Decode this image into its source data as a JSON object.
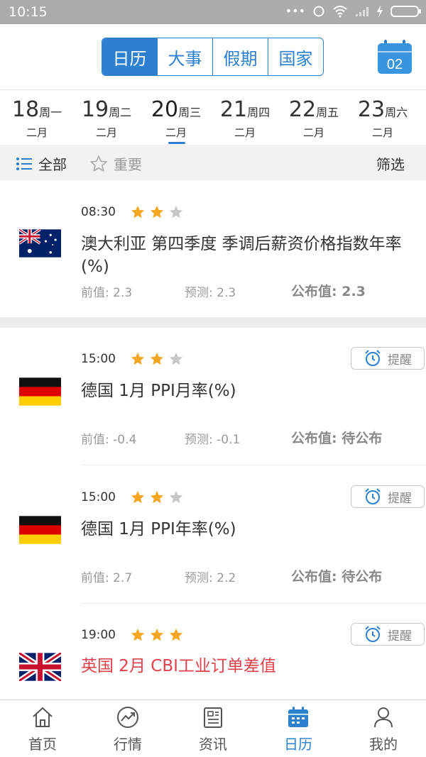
{
  "status_bar": {
    "time": "10:15",
    "dots": "•••"
  },
  "header": {
    "tabs": [
      {
        "label": "日历",
        "active": true
      },
      {
        "label": "大事",
        "active": false
      },
      {
        "label": "假期",
        "active": false
      },
      {
        "label": "国家",
        "active": false
      }
    ],
    "calendar_button_day": "02"
  },
  "dates": [
    {
      "day": "18",
      "weekday": "周一",
      "month": "二月",
      "active": false
    },
    {
      "day": "19",
      "weekday": "周二",
      "month": "二月",
      "active": false
    },
    {
      "day": "20",
      "weekday": "周三",
      "month": "二月",
      "active": true
    },
    {
      "day": "21",
      "weekday": "周四",
      "month": "二月",
      "active": false
    },
    {
      "day": "22",
      "weekday": "周五",
      "month": "二月",
      "active": false
    },
    {
      "day": "23",
      "weekday": "周六",
      "month": "二月",
      "active": false
    }
  ],
  "filter": {
    "all_label": "全部",
    "important_label": "重要",
    "screen_label": "筛选"
  },
  "events": [
    {
      "time": "08:30",
      "stars": 2,
      "flag": "australia-flag",
      "title": "澳大利亚 第四季度 季调后薪资价格指数年率(%)",
      "previous": "前值: 2.3",
      "forecast": "预测: 2.3",
      "actual_label": "公布值: ",
      "actual": "2.3",
      "remind": null
    },
    {
      "time": "15:00",
      "stars": 2,
      "flag": "germany-flag",
      "title": "德国 1月 PPI月率(%)",
      "previous": "前值: -0.4",
      "forecast": "预测: -0.1",
      "actual_label": "公布值: ",
      "actual": "待公布",
      "remind": "提醒"
    },
    {
      "time": "15:00",
      "stars": 2,
      "flag": "germany-flag",
      "title": "德国 1月 PPI年率(%)",
      "previous": "前值: 2.7",
      "forecast": "预测: 2.2",
      "actual_label": "公布值: ",
      "actual": "待公布",
      "remind": "提醒"
    },
    {
      "time": "19:00",
      "stars": 3,
      "flag": "uk-flag",
      "title": "英国 2月 CBI工业订单差值",
      "remind": "提醒"
    }
  ],
  "bottom_nav": [
    {
      "label": "首页",
      "icon": "home-icon",
      "active": false
    },
    {
      "label": "行情",
      "icon": "chart-trend-icon",
      "active": false
    },
    {
      "label": "资讯",
      "icon": "news-icon",
      "active": false
    },
    {
      "label": "日历",
      "icon": "calendar-icon",
      "active": true
    },
    {
      "label": "我的",
      "icon": "profile-icon",
      "active": false
    }
  ],
  "colors": {
    "accent": "#2c80cf",
    "star_on": "#f5a623",
    "star_off": "#c8c8c8",
    "important_red": "#e0414b"
  }
}
